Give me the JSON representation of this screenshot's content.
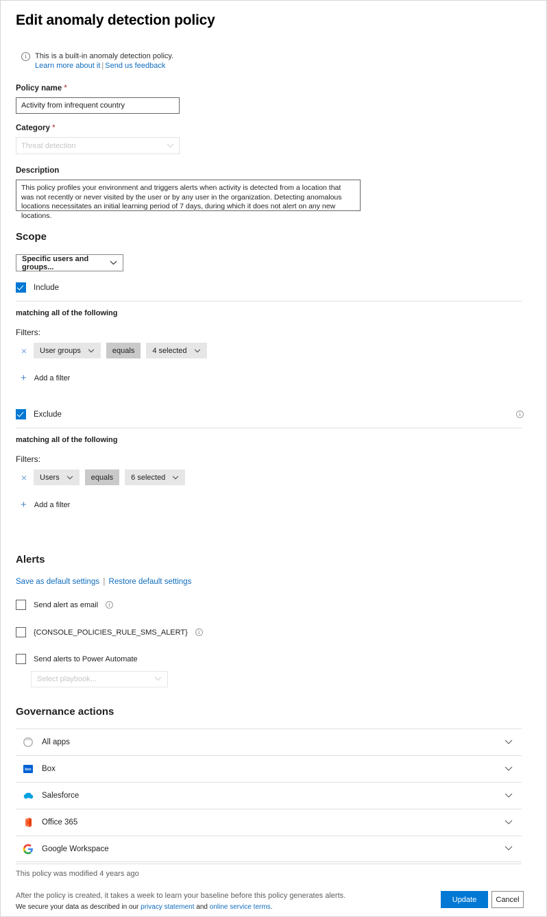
{
  "page": {
    "title": "Edit anomaly detection policy"
  },
  "banner": {
    "icon": "info-circle-icon",
    "text": "This is a built-in anomaly detection policy.",
    "link_learn": "Learn more about it",
    "separator": "|",
    "link_feedback": "Send us feedback"
  },
  "policy_name": {
    "label": "Policy name",
    "required_mark": "*",
    "value": "Activity from infrequent country"
  },
  "category": {
    "label": "Category",
    "required_mark": "*",
    "value": "Threat detection",
    "chevron": "chevron-down-icon"
  },
  "description": {
    "label": "Description",
    "value": "This policy profiles your environment and triggers alerts when activity is detected from a location that was not recently or never visited by the user or by any user in the organization. Detecting anomalous locations necessitates an initial learning period of 7 days, during which it does not alert on any new locations."
  },
  "scope": {
    "heading": "Scope",
    "select_value": "Specific users and groups...",
    "include": {
      "label": "Include",
      "checked": true,
      "matching_text": "matching all of the following",
      "filters_label": "Filters:",
      "filters": [
        {
          "remove": "×",
          "field": "User groups",
          "operator": "equals",
          "value": "4 selected"
        }
      ],
      "add_filter": "Add a filter"
    },
    "exclude": {
      "label": "Exclude",
      "checked": true,
      "info_icon": "info-circle-icon",
      "matching_text": "matching all of the following",
      "filters_label": "Filters:",
      "filters": [
        {
          "remove": "×",
          "field": "Users",
          "operator": "equals",
          "value": "6 selected"
        }
      ],
      "add_filter": "Add a filter"
    }
  },
  "alerts": {
    "heading": "Alerts",
    "link_save_default": "Save as default settings",
    "separator": "|",
    "link_restore_default": "Restore default settings",
    "options": [
      {
        "label": "Send alert as email",
        "checked": false,
        "has_info": true
      },
      {
        "label": "{CONSOLE_POLICIES_RULE_SMS_ALERT}",
        "checked": false,
        "has_info": true
      },
      {
        "label": "Send alerts to Power Automate",
        "checked": false,
        "has_info": false
      }
    ],
    "playbook_placeholder": "Select playbook..."
  },
  "governance": {
    "heading": "Governance actions",
    "rows": [
      {
        "name": "All apps",
        "icon": "all-apps-icon",
        "chevron": "chevron-down-icon"
      },
      {
        "name": "Box",
        "icon": "box-icon",
        "chevron": "chevron-down-icon"
      },
      {
        "name": "Salesforce",
        "icon": "salesforce-icon",
        "chevron": "chevron-down-icon"
      },
      {
        "name": "Office 365",
        "icon": "office365-icon",
        "chevron": "chevron-down-icon"
      },
      {
        "name": "Google Workspace",
        "icon": "google-workspace-icon",
        "chevron": "chevron-down-icon"
      }
    ]
  },
  "footer": {
    "modified_text": "This policy was modified 4 years ago",
    "note_line1": "After the policy is created, it takes a week to learn your baseline before this policy generates alerts.",
    "note_line2_pre": "We secure your data as described in our ",
    "note_link_privacy": "privacy statement",
    "note_line2_mid": " and ",
    "note_link_terms": "online service terms",
    "note_line2_end": ".",
    "update_label": "Update",
    "cancel_label": "Cancel"
  },
  "colors": {
    "accent": "#0078d4",
    "link": "#0f6cbd",
    "required": "#a4262c",
    "pill": "#e6e6e6",
    "pill_operator": "#c9c9c9"
  }
}
